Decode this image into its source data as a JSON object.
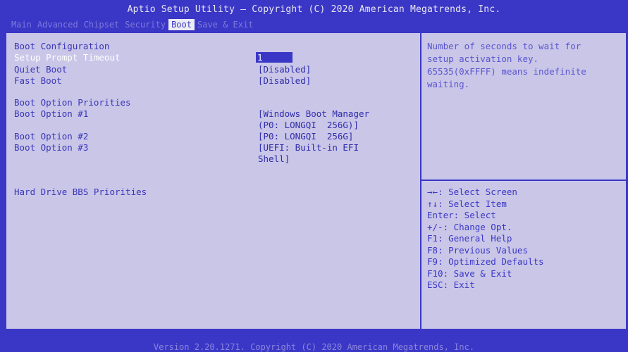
{
  "header": {
    "title": "Aptio Setup Utility – Copyright (C) 2020 American Megatrends, Inc."
  },
  "tabs": [
    {
      "label": "Main",
      "active": false
    },
    {
      "label": "Advanced",
      "active": false
    },
    {
      "label": "Chipset",
      "active": false
    },
    {
      "label": "Security",
      "active": false
    },
    {
      "label": "Boot",
      "active": true
    },
    {
      "label": "Save & Exit",
      "active": false
    }
  ],
  "settings": {
    "section_boot_configuration": "Boot Configuration",
    "setup_prompt_timeout": {
      "label": "Setup Prompt Timeout",
      "value": "1"
    },
    "quiet_boot": {
      "label": "Quiet Boot",
      "value": "[Disabled]"
    },
    "fast_boot": {
      "label": "Fast Boot",
      "value": "[Disabled]"
    },
    "section_boot_option_priorities": "Boot Option Priorities",
    "boot_option_1": {
      "label": "Boot Option #1",
      "value_line1": "[Windows Boot Manager",
      "value_line2": "(P0: LONGQI  256G)]"
    },
    "boot_option_2": {
      "label": "Boot Option #2",
      "value": "[P0: LONGQI  256G]"
    },
    "boot_option_3": {
      "label": "Boot Option #3",
      "value_line1": "[UEFI: Built-in EFI",
      "value_line2": "Shell]"
    },
    "hard_drive_bbs": {
      "label": "Hard Drive BBS Priorities"
    }
  },
  "help": {
    "line1": "Number of seconds to wait for",
    "line2": "setup activation key.",
    "line3": "65535(0xFFFF) means indefinite",
    "line4": "waiting."
  },
  "keys": [
    "→←: Select Screen",
    "↑↓: Select Item",
    "Enter: Select",
    "+/-: Change Opt.",
    "F1: General Help",
    "F8: Previous Values",
    "F9: Optimized Defaults",
    "F10: Save & Exit",
    "ESC: Exit"
  ],
  "footer": {
    "text": "Version 2.20.1271. Copyright (C) 2020 American Megatrends, Inc."
  },
  "colors": {
    "background": "#3b37c6",
    "panel": "#c9c6e8",
    "accent_text": "#3a36b8",
    "selected_text": "#ffffff"
  }
}
